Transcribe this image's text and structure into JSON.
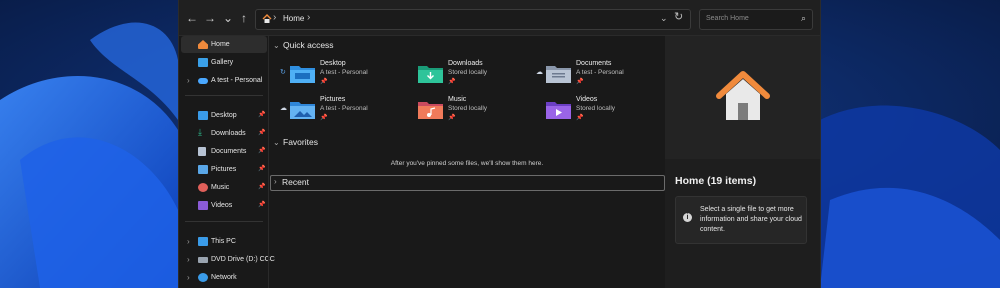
{
  "colors": {
    "accent": "#4cc2ff",
    "window_bg": "#191919",
    "wallpaper": "#0b1e4a"
  },
  "toolbar": {
    "back_icon": "arrow-left-icon",
    "forward_icon": "arrow-right-icon",
    "recent_icon": "chevron-down-icon",
    "up_icon": "arrow-up-icon",
    "breadcrumb": "Home",
    "refresh_icon": "refresh-icon",
    "search_placeholder": "Search Home"
  },
  "sidebar": {
    "top": [
      {
        "label": "Home",
        "icon": "home-icon",
        "active": true
      },
      {
        "label": "Gallery",
        "icon": "gallery-icon"
      },
      {
        "label": "A test - Personal",
        "icon": "onedrive-icon",
        "expandable": true
      }
    ],
    "pinned": [
      {
        "label": "Desktop",
        "icon": "desktop-icon"
      },
      {
        "label": "Downloads",
        "icon": "downloads-icon"
      },
      {
        "label": "Documents",
        "icon": "documents-icon"
      },
      {
        "label": "Pictures",
        "icon": "pictures-icon"
      },
      {
        "label": "Music",
        "icon": "music-icon"
      },
      {
        "label": "Videos",
        "icon": "videos-icon"
      }
    ],
    "drives": [
      {
        "label": "This PC",
        "icon": "pc-icon"
      },
      {
        "label": "DVD Drive (D:) CCC",
        "icon": "dvd-icon"
      },
      {
        "label": "Network",
        "icon": "network-icon"
      }
    ]
  },
  "main": {
    "quick_access_label": "Quick access",
    "favorites_label": "Favorites",
    "favorites_empty": "After you've pinned some files, we'll show them here.",
    "recent_label": "Recent",
    "quick_access": [
      {
        "name": "Desktop",
        "location": "A test - Personal",
        "icon": "desktop-folder-icon",
        "cloud": true
      },
      {
        "name": "Downloads",
        "location": "Stored locally",
        "icon": "downloads-folder-icon"
      },
      {
        "name": "Documents",
        "location": "A test - Personal",
        "icon": "documents-folder-icon",
        "cloud": true
      },
      {
        "name": "Pictures",
        "location": "A test - Personal",
        "icon": "pictures-folder-icon",
        "cloud": true
      },
      {
        "name": "Music",
        "location": "Stored locally",
        "icon": "music-folder-icon"
      },
      {
        "name": "Videos",
        "location": "Stored locally",
        "icon": "videos-folder-icon"
      }
    ]
  },
  "details": {
    "title": "Home (19 items)",
    "info": "Select a single file to get more information and share your cloud content.",
    "preview_icon": "home-large-icon"
  }
}
